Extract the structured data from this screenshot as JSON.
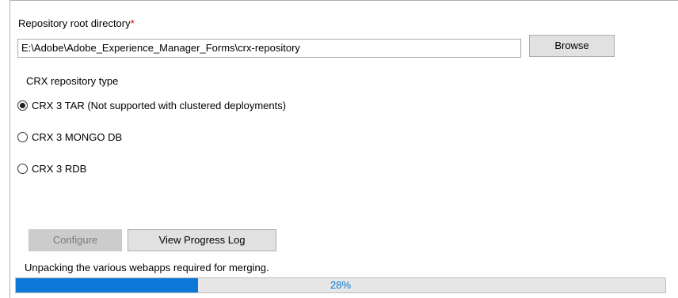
{
  "repository": {
    "label": "Repository root directory",
    "required_marker": "*",
    "path_value": "E:\\Adobe\\Adobe_Experience_Manager_Forms\\crx-repository",
    "browse_label": "Browse"
  },
  "repo_type": {
    "label": "CRX repository type",
    "options": [
      {
        "label": "CRX 3 TAR (Not supported with clustered deployments)",
        "selected": true
      },
      {
        "label": "CRX 3 MONGO DB",
        "selected": false
      },
      {
        "label": "CRX 3 RDB",
        "selected": false
      }
    ]
  },
  "actions": {
    "configure_label": "Configure",
    "configure_enabled": false,
    "view_log_label": "View Progress Log"
  },
  "progress": {
    "status_text": "Unpacking the various webapps required for merging.",
    "percent": 28,
    "percent_text": "28%",
    "fill_color": "#0b78d7",
    "text_color": "#0b78d7"
  },
  "colors": {
    "required_marker": "#d40000"
  }
}
